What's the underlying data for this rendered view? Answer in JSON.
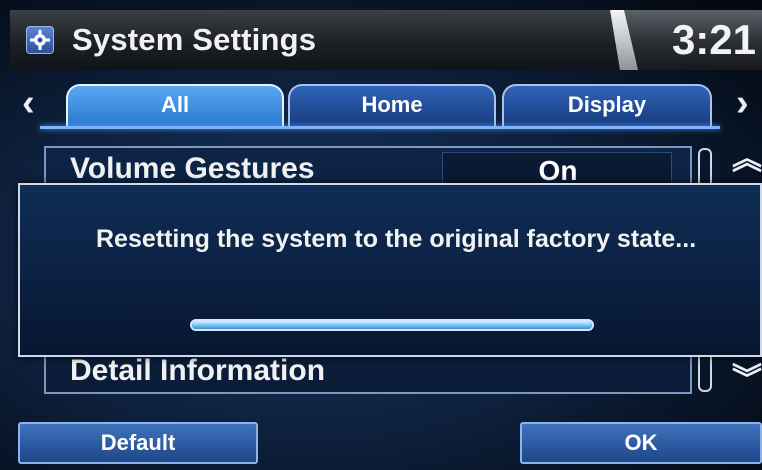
{
  "header": {
    "title": "System Settings",
    "clock": "3:21",
    "icon": "gear-icon"
  },
  "tabs": [
    {
      "label": "All",
      "active": true
    },
    {
      "label": "Home",
      "active": false
    },
    {
      "label": "Display",
      "active": false
    }
  ],
  "nav": {
    "prev": "‹",
    "next": "›"
  },
  "list": {
    "rows": [
      {
        "label": "Volume Gestures",
        "value": "On"
      },
      {
        "label": "Detail Information",
        "value": ""
      }
    ]
  },
  "dialog": {
    "message": "Resetting the system to the original factory state...",
    "progress": 1.0
  },
  "buttons": {
    "default_label": "Default",
    "ok_label": "OK"
  },
  "colors": {
    "accent": "#2b78d0",
    "background": "#0e2240"
  }
}
